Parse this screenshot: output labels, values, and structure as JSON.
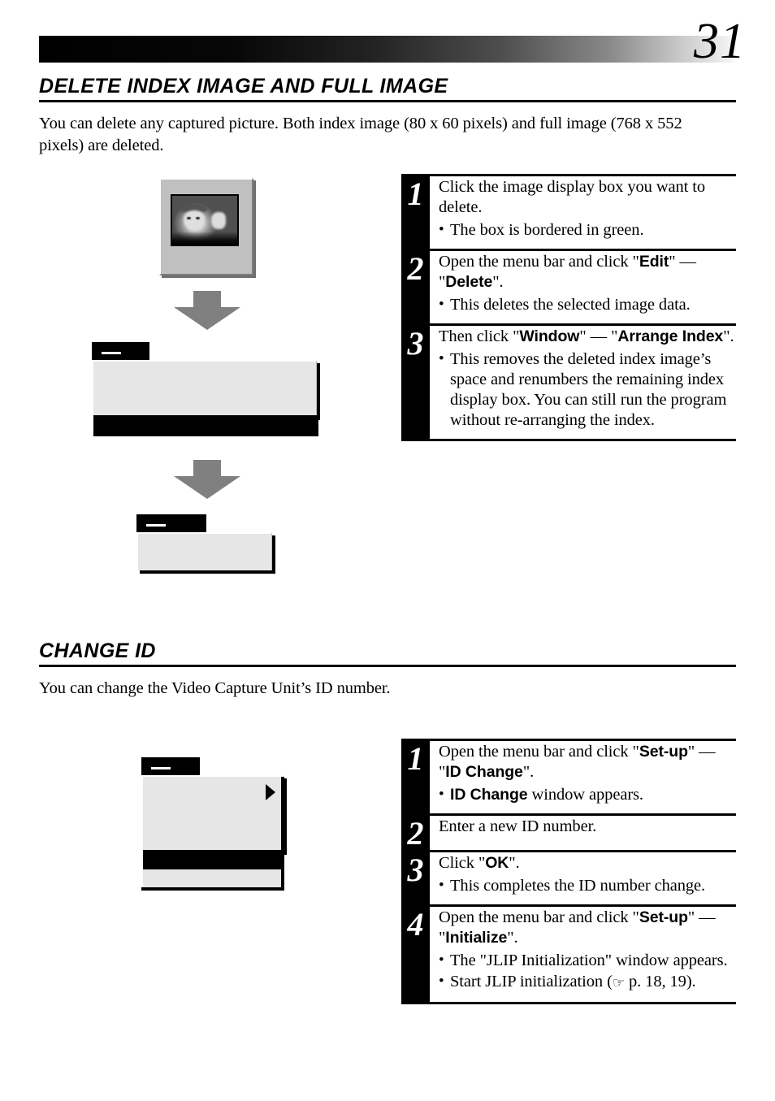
{
  "page": {
    "number": "31",
    "gradient_from": "#000000",
    "gradient_to": "#ffffff"
  },
  "sections": [
    {
      "id": "delete-index-image",
      "title": "DELETE INDEX IMAGE AND FULL IMAGE",
      "intro": "You can delete any captured picture. Both index image (80 x 60 pixels) and full image (768 x 552 pixels) are deleted.",
      "steps": [
        {
          "number": "1",
          "main_parts": [
            {
              "text": "Click the image display box you want to delete.",
              "bold": false
            }
          ],
          "bullets": [
            [
              {
                "text": "The box is bordered in green.",
                "bold": false
              }
            ]
          ]
        },
        {
          "number": "2",
          "main_parts": [
            {
              "text": "Open the menu bar and click \"",
              "bold": false
            },
            {
              "text": "Edit",
              "bold": true
            },
            {
              "text": "\" — \"",
              "bold": false
            },
            {
              "text": "Delete",
              "bold": true
            },
            {
              "text": "\".",
              "bold": false
            }
          ],
          "bullets": [
            [
              {
                "text": "This deletes the selected image data.",
                "bold": false
              }
            ]
          ]
        },
        {
          "number": "3",
          "main_parts": [
            {
              "text": "Then click \"",
              "bold": false
            },
            {
              "text": "Window",
              "bold": true
            },
            {
              "text": "\" — \"",
              "bold": false
            },
            {
              "text": "Arrange Index",
              "bold": true
            },
            {
              "text": "\".",
              "bold": false
            }
          ],
          "bullets": [
            [
              {
                "text": "This removes the deleted index image’s space and renumbers the remaining index display box.  You can still run the program without re-arranging the index.",
                "bold": false
              }
            ]
          ]
        }
      ]
    },
    {
      "id": "change-id",
      "title": "CHANGE ID",
      "intro": "You can change the Video Capture Unit’s ID number.",
      "steps": [
        {
          "number": "1",
          "main_parts": [
            {
              "text": "Open the menu bar and click \"",
              "bold": false
            },
            {
              "text": "Set-up",
              "bold": true
            },
            {
              "text": "\" — \"",
              "bold": false
            },
            {
              "text": "ID Change",
              "bold": true
            },
            {
              "text": "\".",
              "bold": false
            }
          ],
          "bullets": [
            [
              {
                "text": "ID Change",
                "bold": true
              },
              {
                "text": " window appears.",
                "bold": false
              }
            ]
          ]
        },
        {
          "number": "2",
          "main_parts": [
            {
              "text": "Enter a new ID number.",
              "bold": false
            }
          ],
          "bullets": []
        },
        {
          "number": "3",
          "main_parts": [
            {
              "text": "Click \"",
              "bold": false
            },
            {
              "text": "OK",
              "bold": true
            },
            {
              "text": "\".",
              "bold": false
            }
          ],
          "bullets": [
            [
              {
                "text": "This completes the ID number change.",
                "bold": false
              }
            ]
          ]
        },
        {
          "number": "4",
          "main_parts": [
            {
              "text": "Open the menu bar and click \"",
              "bold": false
            },
            {
              "text": "Set-up",
              "bold": true
            },
            {
              "text": "\" — \"",
              "bold": false
            },
            {
              "text": "Initialize",
              "bold": true
            },
            {
              "text": "\".",
              "bold": false
            }
          ],
          "bullets": [
            [
              {
                "text": "The \"JLIP Initialization\" window appears.",
                "bold": false
              }
            ],
            [
              {
                "text": "Start JLIP initialization (",
                "bold": false
              },
              {
                "text": "☞",
                "bold": false,
                "icon": "pointing-hand-icon"
              },
              {
                "text": " p. 18, 19).",
                "bold": false
              }
            ]
          ]
        }
      ]
    }
  ],
  "illustrations": {
    "image_display_box": {
      "name": "image-display-box-window",
      "fill": "#c0c0c0",
      "photo_border": "#000000",
      "photo_caption": "grayscale photo of a child wearing a cap"
    },
    "arrows": {
      "fill": "#808080",
      "direction": "down"
    },
    "edit_delete_menu": {
      "name": "edit-menu-dropdown",
      "tab_fill": "#000000",
      "body_fill": "#e6e6e6",
      "highlight_fill": "#000000"
    },
    "window_arrange_menu": {
      "name": "window-menu-dropdown",
      "tab_fill": "#000000",
      "body_fill": "#e6e6e6"
    },
    "setup_id_change_menu": {
      "name": "setup-menu-dropdown",
      "tab_fill": "#000000",
      "body_fill": "#e6e6e6",
      "highlight_fill": "#000000",
      "submenu_arrow": "▶"
    }
  }
}
